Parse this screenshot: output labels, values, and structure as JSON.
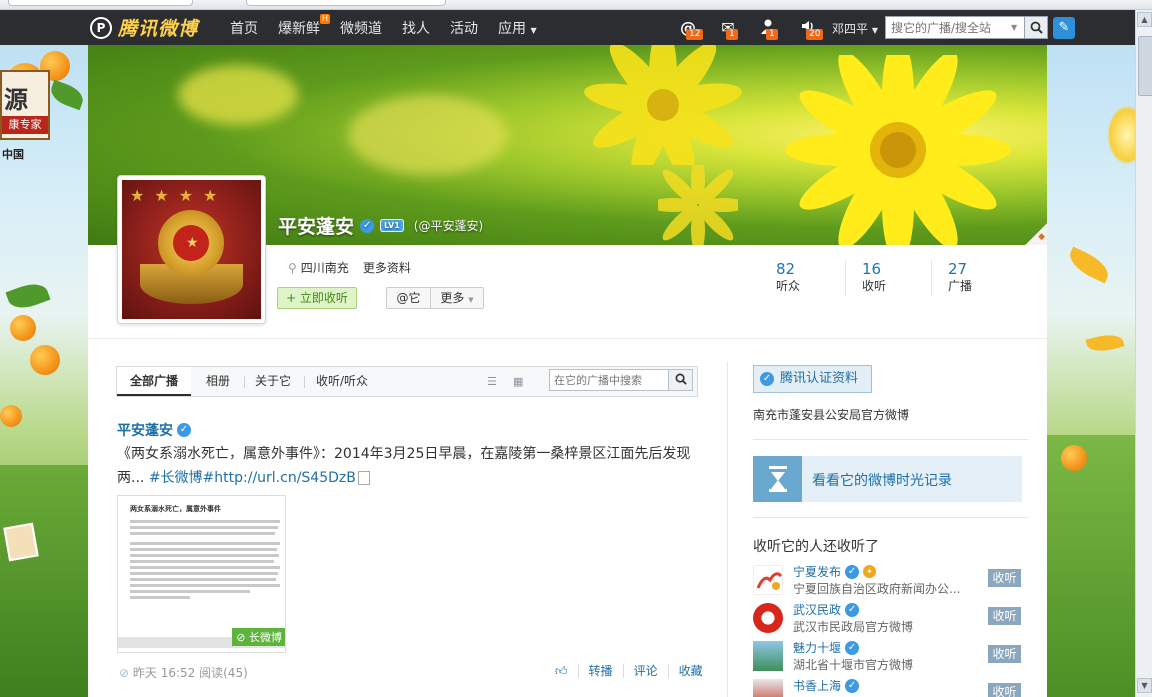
{
  "nav": {
    "logo_mark": "P",
    "logo_text": "腾讯微博",
    "links": [
      "首页",
      "爆新鲜",
      "微频道",
      "找人",
      "活动",
      "应用"
    ],
    "hot_badge": "H",
    "counts": {
      "mention": "12",
      "mail": "1",
      "follower": "1",
      "broadcast": "20"
    },
    "user": "邓四平",
    "search_placeholder": "搜它的广播/搜全站"
  },
  "side_ad": {
    "title": "源",
    "tagline": "康专家",
    "sub": "中国"
  },
  "profile": {
    "name": "平安蓬安",
    "level": "LV1",
    "handle": "(@平安蓬安)",
    "location": "四川南充",
    "more_info": "更多资料",
    "follow_button": "+ 立即收听",
    "at_button": "@它",
    "more_button": "更多",
    "stats": [
      {
        "number": "82",
        "label": "听众"
      },
      {
        "number": "16",
        "label": "收听"
      },
      {
        "number": "27",
        "label": "广播"
      }
    ]
  },
  "tabs": {
    "items": [
      "全部广播",
      "相册",
      "关于它",
      "收听/听众"
    ],
    "search_placeholder": "在它的广播中搜索"
  },
  "post": {
    "author": "平安蓬安",
    "text": "《两女系溺水死亡，属意外事件》：2014年3月25日早晨，在嘉陵第一桑梓景区江面先后发现两...",
    "links": "#长微博#http://url.cn/S45DzB",
    "thumb_title": "两女系溺水死亡，属意外事件",
    "thumb_tag": "长微博",
    "time": "昨天 16:52",
    "reads": "阅读(45)",
    "actions": [
      "转播",
      "评论",
      "收藏"
    ]
  },
  "sidebar": {
    "auth_button": "腾讯认证资料",
    "auth_desc": "南充市蓬安县公安局官方微博",
    "timeline_link": "看看它的微博时光记录",
    "also_title": "收听它的人还收听了",
    "recs": [
      {
        "name": "宁夏发布",
        "desc": "宁夏回族自治区政府新闻办公...",
        "button": "收听"
      },
      {
        "name": "武汉民政",
        "desc": "武汉市民政局官方微博",
        "button": "收听"
      },
      {
        "name": "魅力十堰",
        "desc": "湖北省十堰市官方微博",
        "button": "收听"
      },
      {
        "name": "书香上海",
        "desc": "",
        "button": "收听"
      }
    ]
  }
}
